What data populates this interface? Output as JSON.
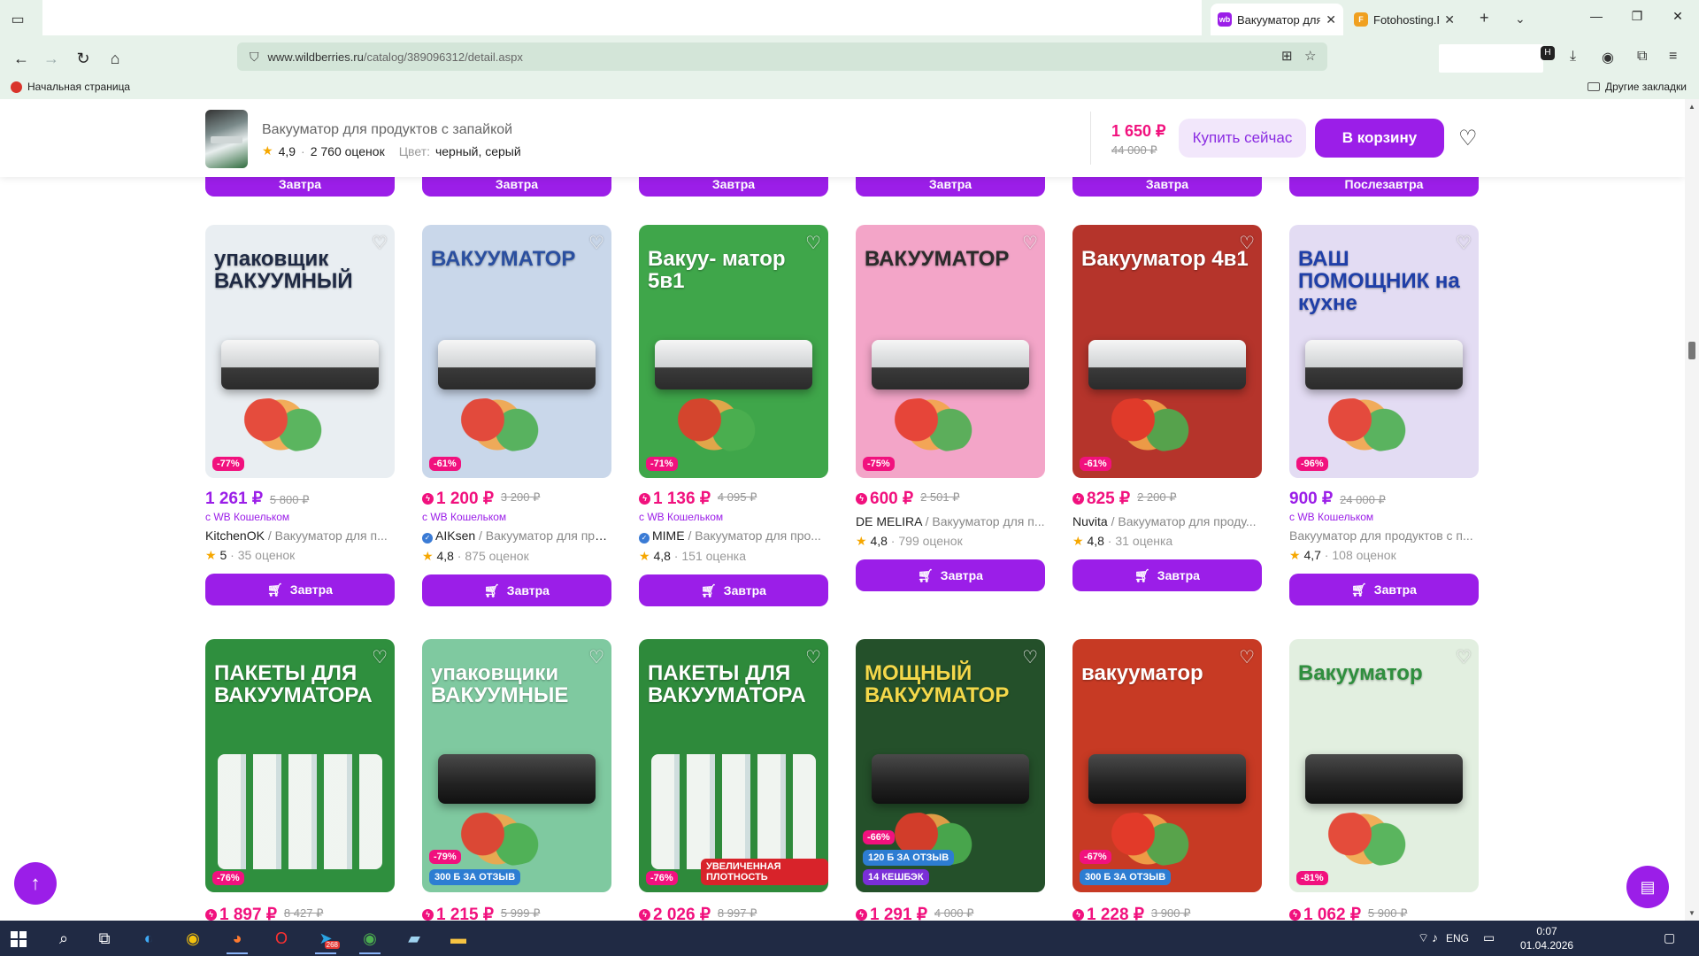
{
  "browser": {
    "tabs": [
      {
        "title": "Вакууматор для",
        "favicon_text": "wb",
        "favicon_color": "#9b1ee8",
        "active": true
      },
      {
        "title": "Fotohosting.Pro",
        "favicon_text": "F",
        "favicon_color": "#f0a020",
        "active": false
      }
    ],
    "url_host": "www.wildberries.ru",
    "url_path": "/catalog/389096312/detail.aspx",
    "bookmarks": {
      "home": "Начальная страница",
      "other": "Другие закладки"
    }
  },
  "sticky": {
    "title": "Вакууматор для продуктов с запайкой",
    "rating": "4,9",
    "reviews": "2 760 оценок",
    "color_label": "Цвет:",
    "color_value": "черный, серый",
    "price": "1 650 ₽",
    "old_price": "44 000 ₽",
    "buy_now": "Купить сейчас",
    "to_cart": "В корзину"
  },
  "partial_buttons": [
    "Завтра",
    "Завтра",
    "Завтра",
    "Завтра",
    "Завтра",
    "Послезавтра"
  ],
  "products_row1": [
    {
      "img_headline": "упаковщик ВАКУУМНЫЙ",
      "bg": "#e9eef2",
      "headline_color": "#1f2a44",
      "discount": "-77%",
      "price": "1 261 ₽",
      "bolt": false,
      "old": "5 800 ₽",
      "wallet": "с WB Кошельком",
      "brand": "KitchenOK",
      "name": " / Вакууматор для п...",
      "verified": false,
      "rating": "5",
      "reviews": "35 оценок",
      "delivery": "Завтра"
    },
    {
      "img_headline": "ВАКУУМАТОР",
      "bg": "#c9d7ea",
      "headline_color": "#2a4fa0",
      "discount": "-61%",
      "price": "1 200 ₽",
      "bolt": true,
      "old": "3 200 ₽",
      "wallet": "с WB Кошельком",
      "brand": "AIKsen",
      "name": " / Вакууматор для про...",
      "verified": true,
      "rating": "4,8",
      "reviews": "875 оценок",
      "delivery": "Завтра"
    },
    {
      "img_headline": "Вакуу- матор 5в1",
      "bg": "#3fa64a",
      "headline_color": "#ffffff",
      "discount": "-71%",
      "price": "1 136 ₽",
      "bolt": true,
      "old": "4 095 ₽",
      "wallet": "с WB Кошельком",
      "brand": "MIME",
      "name": " / Вакууматор для про...",
      "verified": true,
      "rating": "4,8",
      "reviews": "151 оценка",
      "delivery": "Завтра"
    },
    {
      "img_headline": "ВАКУУМАТОР",
      "bg": "#f3a5c8",
      "headline_color": "#2b2b2b",
      "discount": "-75%",
      "price": "600 ₽",
      "bolt": true,
      "old": "2 501 ₽",
      "wallet": "",
      "brand": "DE MELIRA",
      "name": " / Вакууматор для п...",
      "verified": false,
      "rating": "4,8",
      "reviews": "799 оценок",
      "delivery": "Завтра"
    },
    {
      "img_headline": "Вакууматор 4в1",
      "bg": "#b5342b",
      "headline_color": "#ffffff",
      "discount": "-61%",
      "price": "825 ₽",
      "bolt": true,
      "old": "2 200 ₽",
      "wallet": "",
      "brand": "Nuvita",
      "name": " / Вакууматор для проду...",
      "verified": false,
      "rating": "4,8",
      "reviews": "31 оценка",
      "delivery": "Завтра"
    },
    {
      "img_headline": "ВАШ ПОМОЩНИК на кухне",
      "bg": "#e3dcf3",
      "headline_color": "#1f3fa8",
      "discount": "-96%",
      "price": "900 ₽",
      "bolt": false,
      "old": "24 000 ₽",
      "wallet": "с WB Кошельком",
      "brand": "",
      "name": "Вакууматор для продуктов с п...",
      "verified": false,
      "rating": "4,7",
      "reviews": "108 оценок",
      "delivery": "Завтра"
    }
  ],
  "products_row2": [
    {
      "img_headline": "ПАКЕТЫ ДЛЯ ВАКУУМАТОРА",
      "bg": "#2f8f3e",
      "headline_color": "#ffffff",
      "discount": "-76%",
      "promo": "",
      "price": "1 897 ₽",
      "old": "8 427 ₽",
      "rolls": true
    },
    {
      "img_headline": "упаковщики ВАКУУМНЫЕ",
      "bg": "#7fc9a0",
      "headline_color": "#ffffff",
      "discount": "-79%",
      "promo": "300 Б ЗА ОТЗЫВ",
      "price": "1 215 ₽",
      "old": "5 999 ₽",
      "rolls": false
    },
    {
      "img_headline": "ПАКЕТЫ ДЛЯ ВАКУУМАТОРА",
      "bg": "#2e8a3b",
      "headline_color": "#ffffff",
      "discount": "-76%",
      "promo": "УВЕЛИЧЕННАЯ ПЛОТНОСТЬ",
      "price": "2 026 ₽",
      "old": "8 997 ₽",
      "rolls": true
    },
    {
      "img_headline": "МОЩНЫЙ ВАКУУМАТОР",
      "bg": "#24502a",
      "headline_color": "#f4d84a",
      "discount": "-66%",
      "promo": "120 Б ЗА ОТЗЫВ",
      "cashback": "14 КЕШБЭК",
      "price": "1 291 ₽",
      "old": "4 000 ₽",
      "rolls": false
    },
    {
      "img_headline": "вакууматор",
      "bg": "#c73a24",
      "headline_color": "#ffffff",
      "discount": "-67%",
      "promo": "300 Б ЗА ОТЗЫВ",
      "price": "1 228 ₽",
      "old": "3 900 ₽",
      "rolls": false
    },
    {
      "img_headline": "Вакууматор",
      "bg": "#e2efe0",
      "headline_color": "#2f8f3e",
      "discount": "-81%",
      "promo": "",
      "price": "1 062 ₽",
      "old": "5 900 ₽",
      "rolls": false
    }
  ],
  "taskbar": {
    "lang": "ENG",
    "time": "0:07",
    "date": "01.04.2026",
    "telegram_badge": "268"
  }
}
